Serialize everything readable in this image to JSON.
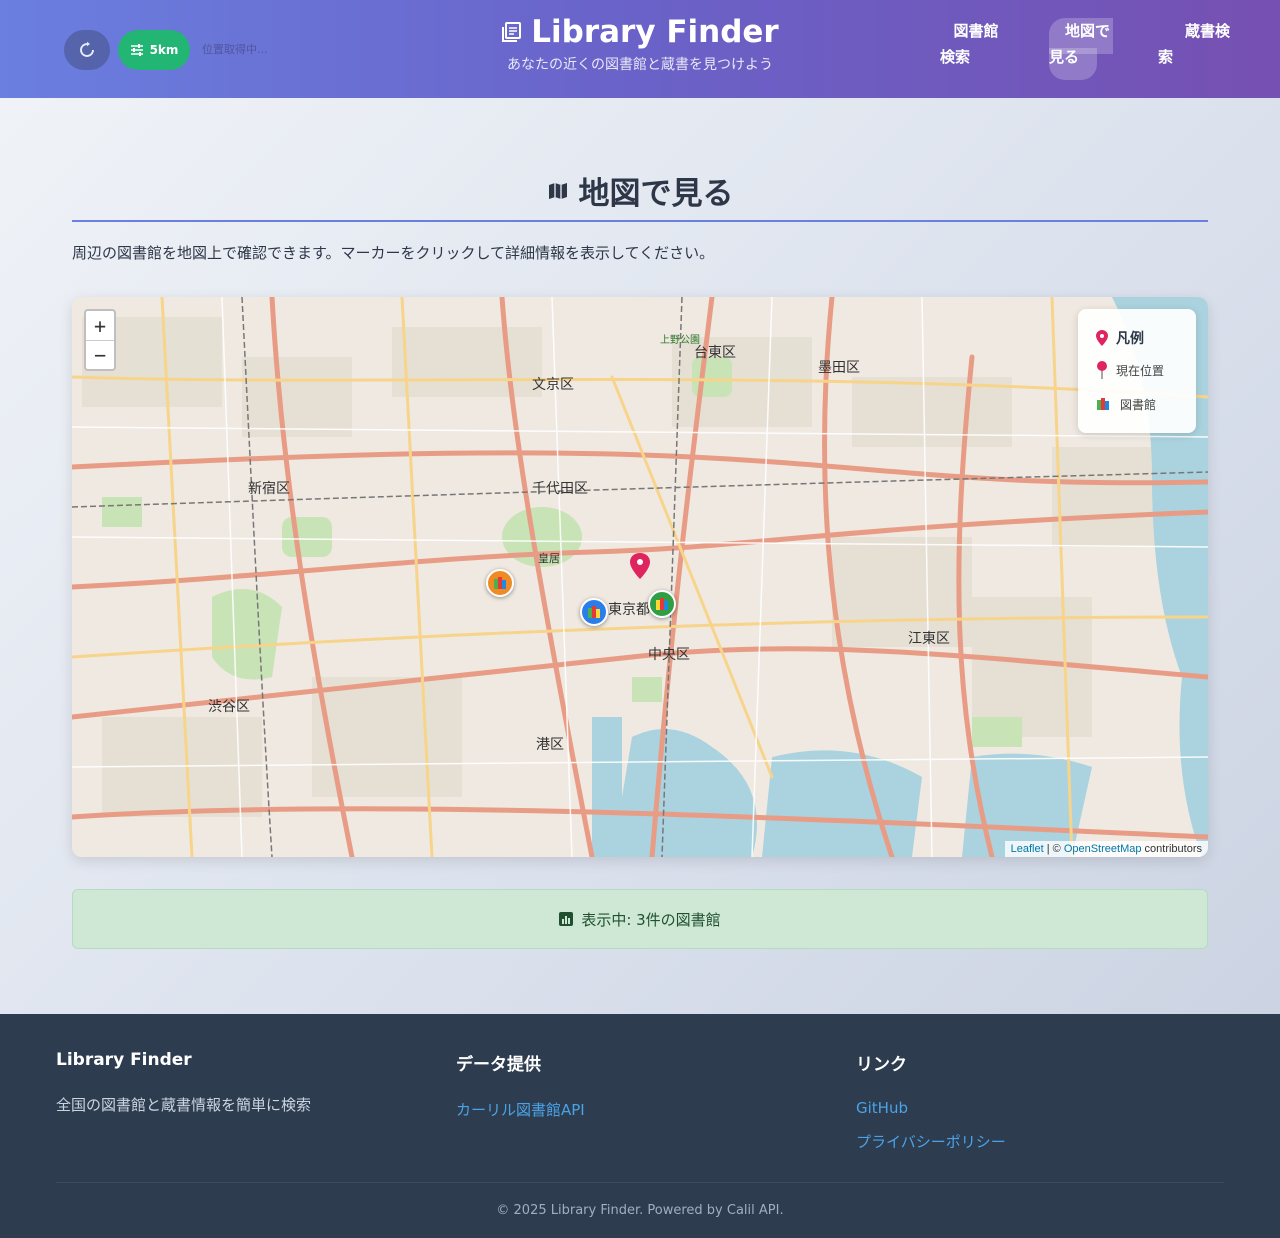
{
  "header": {
    "title": "Library Finder",
    "subtitle": "あなたの近くの図書館と蔵書を見つけよう",
    "radius_label": "5km",
    "location_status": "位置取得中...",
    "nav": [
      {
        "label": "図書館検索",
        "line1": "図書館",
        "line2": "検索"
      },
      {
        "label": "地図で見る",
        "line1": "地図で",
        "line2": "見る",
        "active": true
      },
      {
        "label": "蔵書検索",
        "line1": "蔵書検",
        "line2": "索"
      }
    ]
  },
  "main": {
    "title": "地図で見る",
    "intro": "周辺の図書館を地図上で確認できます。マーカーをクリックして詳細情報を表示してください。",
    "status": "表示中: 3件の図書館"
  },
  "map": {
    "zoom_in": "+",
    "zoom_out": "−",
    "legend": {
      "title": "凡例",
      "current": "現在位置",
      "library": "図書館"
    },
    "attribution": {
      "leaflet": "Leaflet",
      "separator": " | © ",
      "osm": "OpenStreetMap",
      "suffix": " contributors"
    },
    "labels": [
      {
        "text": "文京区"
      },
      {
        "text": "台東区"
      },
      {
        "text": "墨田区"
      },
      {
        "text": "新宿区"
      },
      {
        "text": "千代田区"
      },
      {
        "text": "皇居"
      },
      {
        "text": "東京都"
      },
      {
        "text": "中央区"
      },
      {
        "text": "江東区"
      },
      {
        "text": "港区"
      },
      {
        "text": "渋谷区"
      },
      {
        "text": "上野公園"
      }
    ],
    "marker_colors": [
      "#f08a24",
      "#2b7de9",
      "#2f9e44"
    ]
  },
  "footer": {
    "col1_title": "Library Finder",
    "col1_text": "全国の図書館と蔵書情報を簡単に検索",
    "col2_title": "データ提供",
    "col2_link": "カーリル図書館API",
    "col3_title": "リンク",
    "col3_links": [
      "GitHub",
      "プライバシーポリシー"
    ],
    "copyright": "© 2025 Library Finder. Powered by Calil API."
  }
}
